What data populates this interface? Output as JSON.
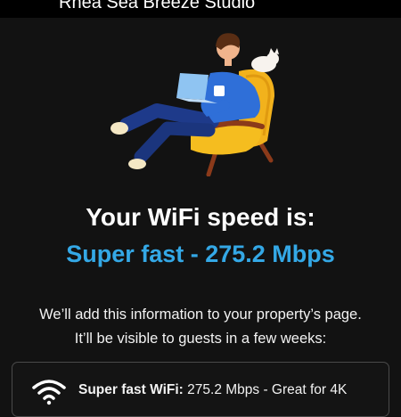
{
  "header": {
    "title": "Rhea Sea Breeze Studio"
  },
  "illustration": {
    "name": "person-relaxing-in-armchair-with-laptop-and-cat"
  },
  "result": {
    "title": "Your WiFi speed is:",
    "speed": "Super fast - 275.2 Mbps"
  },
  "info": {
    "line1": "We’ll add this information to your property’s page.",
    "line2": "It’ll be visible to guests in a few weeks:"
  },
  "card": {
    "icon": "wifi-icon",
    "label": "Super fast WiFi:",
    "detail": "275.2 Mbps - Great for 4K"
  },
  "colors": {
    "accent": "#34a8e6",
    "background": "#121212"
  }
}
